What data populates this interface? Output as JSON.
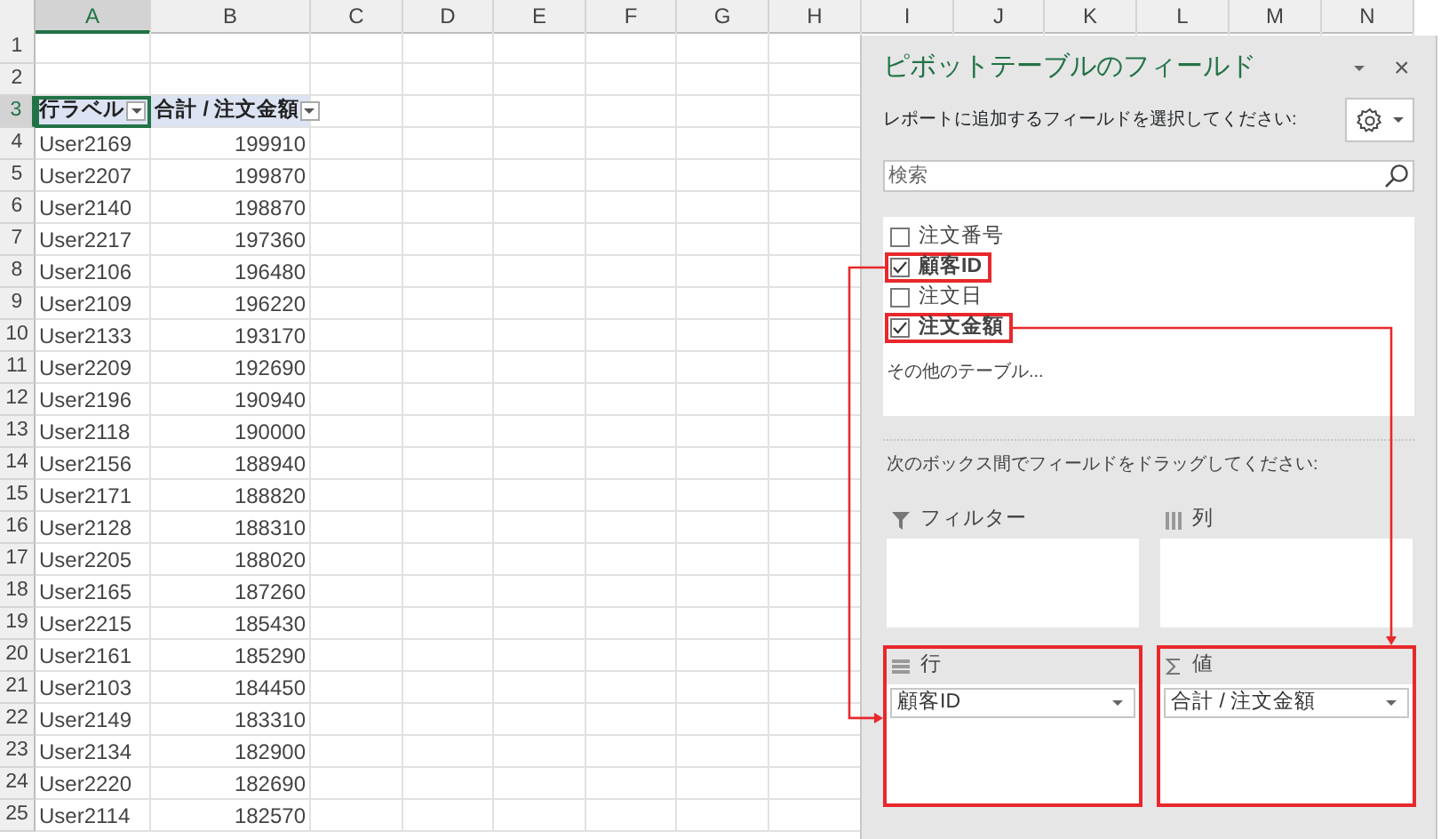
{
  "sheet": {
    "columns": [
      {
        "label": "A",
        "selected": true
      },
      {
        "label": "B",
        "selected": false
      },
      {
        "label": "C",
        "selected": false
      },
      {
        "label": "D",
        "selected": false
      },
      {
        "label": "E",
        "selected": false
      },
      {
        "label": "F",
        "selected": false
      },
      {
        "label": "G",
        "selected": false
      },
      {
        "label": "H",
        "selected": false
      },
      {
        "label": "I",
        "selected": false
      },
      {
        "label": "J",
        "selected": false
      },
      {
        "label": "K",
        "selected": false
      },
      {
        "label": "L",
        "selected": false
      },
      {
        "label": "M",
        "selected": false
      },
      {
        "label": "N",
        "selected": false
      }
    ],
    "rows": [
      {
        "number": "1",
        "kind": "blank",
        "selected": false
      },
      {
        "number": "2",
        "kind": "blank",
        "selected": false
      },
      {
        "number": "3",
        "kind": "header",
        "selected": true,
        "cells": [
          "行ラベル",
          "合計 / 注文金額"
        ]
      },
      {
        "number": "4",
        "kind": "data",
        "selected": false,
        "cells": [
          "User2169",
          "199910"
        ]
      },
      {
        "number": "5",
        "kind": "data",
        "selected": false,
        "cells": [
          "User2207",
          "199870"
        ]
      },
      {
        "number": "6",
        "kind": "data",
        "selected": false,
        "cells": [
          "User2140",
          "198870"
        ]
      },
      {
        "number": "7",
        "kind": "data",
        "selected": false,
        "cells": [
          "User2217",
          "197360"
        ]
      },
      {
        "number": "8",
        "kind": "data",
        "selected": false,
        "cells": [
          "User2106",
          "196480"
        ]
      },
      {
        "number": "9",
        "kind": "data",
        "selected": false,
        "cells": [
          "User2109",
          "196220"
        ]
      },
      {
        "number": "10",
        "kind": "data",
        "selected": false,
        "cells": [
          "User2133",
          "193170"
        ]
      },
      {
        "number": "11",
        "kind": "data",
        "selected": false,
        "cells": [
          "User2209",
          "192690"
        ]
      },
      {
        "number": "12",
        "kind": "data",
        "selected": false,
        "cells": [
          "User2196",
          "190940"
        ]
      },
      {
        "number": "13",
        "kind": "data",
        "selected": false,
        "cells": [
          "User2118",
          "190000"
        ]
      },
      {
        "number": "14",
        "kind": "data",
        "selected": false,
        "cells": [
          "User2156",
          "188940"
        ]
      },
      {
        "number": "15",
        "kind": "data",
        "selected": false,
        "cells": [
          "User2171",
          "188820"
        ]
      },
      {
        "number": "16",
        "kind": "data",
        "selected": false,
        "cells": [
          "User2128",
          "188310"
        ]
      },
      {
        "number": "17",
        "kind": "data",
        "selected": false,
        "cells": [
          "User2205",
          "188020"
        ]
      },
      {
        "number": "18",
        "kind": "data",
        "selected": false,
        "cells": [
          "User2165",
          "187260"
        ]
      },
      {
        "number": "19",
        "kind": "data",
        "selected": false,
        "cells": [
          "User2215",
          "185430"
        ]
      },
      {
        "number": "20",
        "kind": "data",
        "selected": false,
        "cells": [
          "User2161",
          "185290"
        ]
      },
      {
        "number": "21",
        "kind": "data",
        "selected": false,
        "cells": [
          "User2103",
          "184450"
        ]
      },
      {
        "number": "22",
        "kind": "data",
        "selected": false,
        "cells": [
          "User2149",
          "183310"
        ]
      },
      {
        "number": "23",
        "kind": "data",
        "selected": false,
        "cells": [
          "User2134",
          "182900"
        ]
      },
      {
        "number": "24",
        "kind": "data",
        "selected": false,
        "cells": [
          "User2220",
          "182690"
        ]
      },
      {
        "number": "25",
        "kind": "data",
        "selected": false,
        "cells": [
          "User2114",
          "182570"
        ]
      }
    ]
  },
  "pivot_pane": {
    "title": "ピボットテーブルのフィールド",
    "close": "×",
    "instruction": "レポートに追加するフィールドを選択してください:",
    "search": {
      "placeholder": "検索"
    },
    "fields": [
      {
        "label": "注文番号",
        "checked": false,
        "highlighted": false
      },
      {
        "label": "顧客ID",
        "checked": true,
        "highlighted": true
      },
      {
        "label": "注文日",
        "checked": false,
        "highlighted": false
      },
      {
        "label": "注文金額",
        "checked": true,
        "highlighted": true
      }
    ],
    "more_tables": "その他のテーブル...",
    "drag_hint": "次のボックス間でフィールドをドラッグしてください:",
    "areas": [
      {
        "kind": "filters",
        "label": "フィルター",
        "highlighted": false
      },
      {
        "kind": "columns",
        "label": "列",
        "highlighted": false
      },
      {
        "kind": "rows",
        "label": "行",
        "highlighted": true,
        "items": [
          "顧客ID"
        ]
      },
      {
        "kind": "values",
        "label": "値",
        "highlighted": true,
        "items": [
          "合計 / 注文金額"
        ]
      }
    ]
  }
}
